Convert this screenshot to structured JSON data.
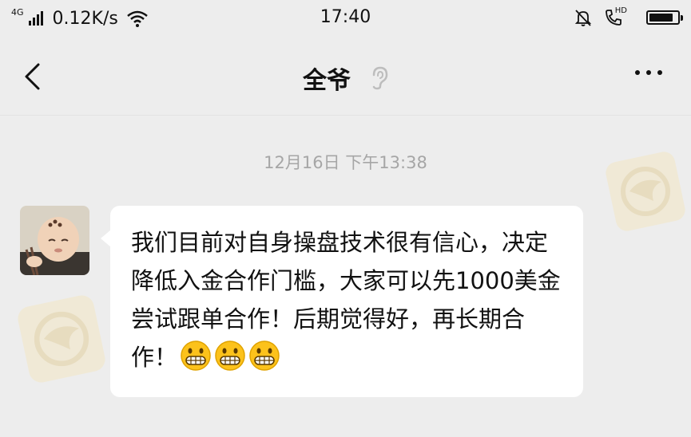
{
  "status_bar": {
    "network_type": "4G",
    "speed": "0.12K/s",
    "time": "17:40",
    "hd_label": "HD",
    "battery_level": 0.85,
    "icons": [
      "signal-icon",
      "wifi-icon",
      "mute-bell-icon",
      "hd-call-icon",
      "battery-icon"
    ]
  },
  "header": {
    "back_icon": "chevron-left-icon",
    "title": "全爷",
    "voice_icon": "ear-icon",
    "more_icon": "ellipsis-icon"
  },
  "chat": {
    "timestamp": "12月16日 下午13:38",
    "messages": [
      {
        "sender": "contact",
        "avatar": "contact-avatar",
        "text": "我们目前对自身操盘技术很有信心，决定降低入金合作门槛，大家可以先1000美金尝试跟单合作！后期觉得好，再长期合作！",
        "emoji": [
          "grinning-face-emoji",
          "grinning-face-emoji",
          "grinning-face-emoji"
        ]
      }
    ]
  },
  "colors": {
    "background": "#ededed",
    "bubble": "#ffffff",
    "timestamp": "#a6a6a6",
    "watermark": "#e8d9b0"
  }
}
